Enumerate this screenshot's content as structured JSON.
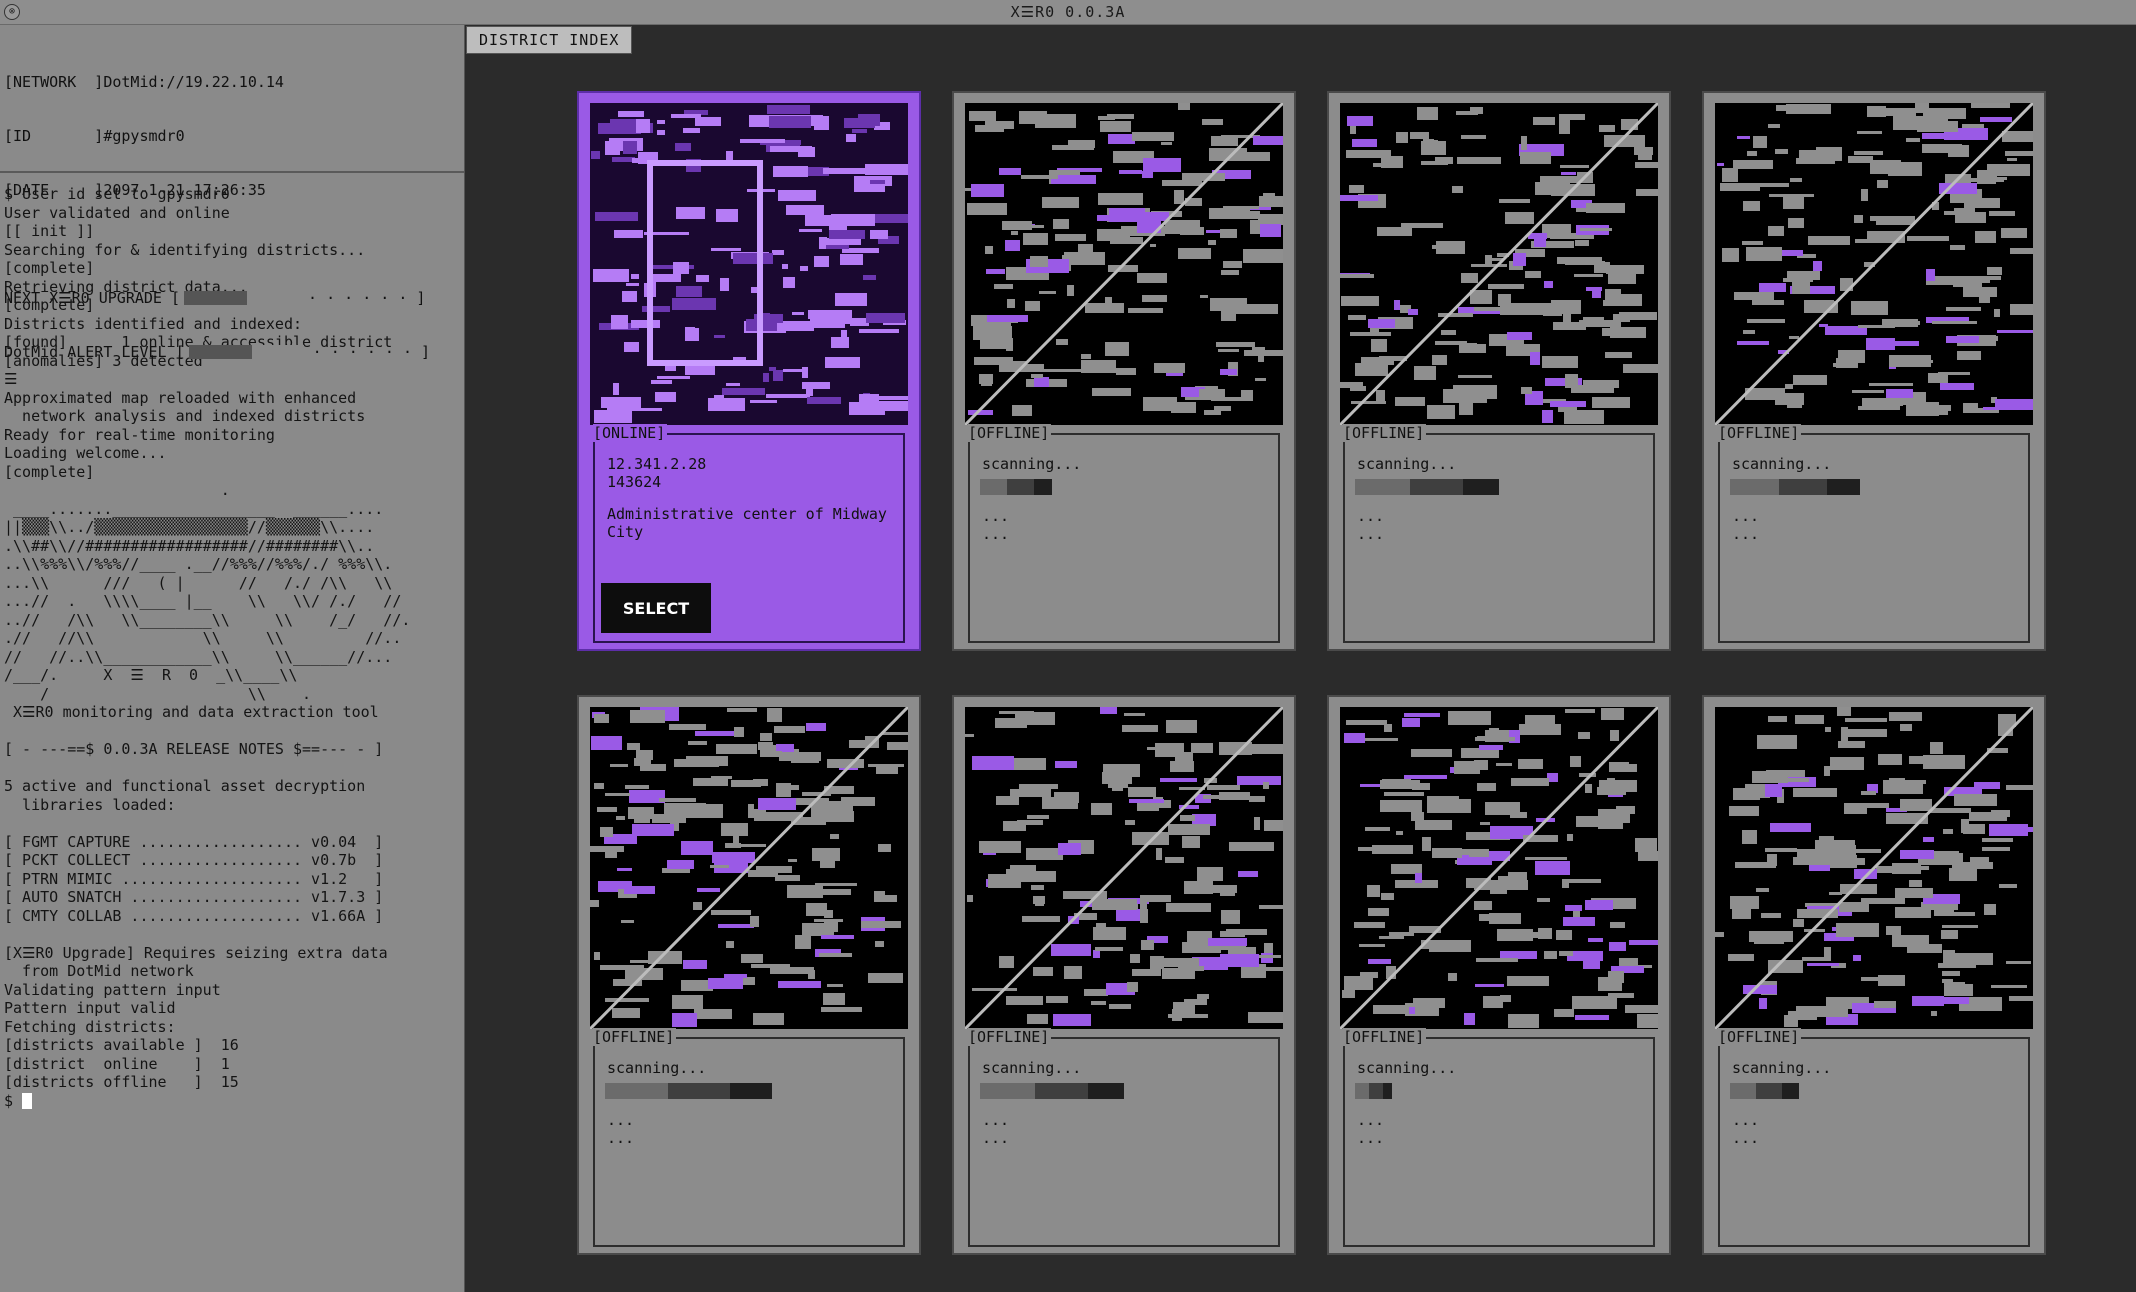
{
  "window": {
    "title": "X☰R0 0.0.3A"
  },
  "status": {
    "network_label": "[NETWORK  ]",
    "network_value": "DotMid://19.22.10.14",
    "id_label": "[ID       ]",
    "id_value": "#gpysmdr0",
    "date_label": "[DATE     ]",
    "date_value": "2097-1-21 17:26:35",
    "upgrade_label": "NEXT X☰R0 UPGRADE [",
    "upgrade_level": 0.55,
    "alert_label": "DotMid ALERT LEVEL [",
    "alert_level": 0.55,
    "meter_tail": " · · · · · · ]"
  },
  "log": [
    "$ User id set to gpysmdr0",
    "User validated and online",
    "[[ init ]]",
    "Searching for & identifying districts...",
    "[complete]",
    "Retrieving district data...",
    "[complete]",
    "Districts identified and indexed:",
    "[found]      1 online & accessible district",
    "[anomalies] 3 detected",
    "☰",
    "Approximated map reloaded with enhanced",
    "  network analysis and indexed districts",
    "Ready for real-time monitoring",
    "Loading welcome...",
    "[complete]",
    "                        .",
    " ____.......__________________  ______....",
    "||▒▒▒\\\\../▒▒▒▒▒▒▒▒▒▒▒▒▒▒▒▒▒//▒▒▒▒▒▒\\\\....",
    ".\\\\##\\\\//##################//########\\\\..",
    "..\\\\%%%\\\\/%%%//____ .__//%%%//%%%/./ %%%\\\\.",
    "...\\\\      ///   ( |      //   /./ /\\\\   \\\\",
    "...//  .   \\\\\\\\____ |__    \\\\   \\\\/ /./   //",
    "..//   /\\\\   \\\\________\\\\     \\\\    /_/   //.",
    ".//   //\\\\            \\\\     \\\\         //..",
    "//   //..\\\\____________\\\\     \\\\______//...",
    "/___/.     X  ☰  R  0  _\\\\____\\\\",
    "    /                      \\\\    .",
    " X☰R0 monitoring and data extraction tool",
    "",
    "[ - ---==$ 0.0.3A RELEASE NOTES $==--- - ]",
    "",
    "5 active and functional asset decryption",
    "  libraries loaded:",
    "",
    "[ FGMT CAPTURE .................. v0.04  ]",
    "[ PCKT COLLECT .................. v0.7b  ]",
    "[ PTRN MIMIC .................... v1.2   ]",
    "[ AUTO SNATCH ................... v1.7.3 ]",
    "[ CMTY COLLAB ................... v1.66A ]",
    "",
    "[X☰R0 Upgrade] Requires seizing extra data",
    "  from DotMid network",
    "Validating pattern input",
    "Pattern input valid",
    "Fetching districts:",
    "[districts available ]  16",
    "[district  online    ]  1",
    "[districts offline   ]  15",
    "$ "
  ],
  "tab": {
    "label": "DISTRICT INDEX"
  },
  "colors": {
    "accent": "#9a5ae6",
    "card": "#8c8c8c",
    "background": "#2b2b2b"
  },
  "cards": [
    {
      "state": "[ONLINE]",
      "ip": "12.341.2.28",
      "code": "143624",
      "description": "Administrative center of Midway City",
      "button": "SELECT"
    },
    {
      "state": "[OFFLINE]",
      "status": "scanning...",
      "progress": 0.25,
      "more": "...\n..."
    },
    {
      "state": "[OFFLINE]",
      "status": "scanning...",
      "progress": 0.5,
      "more": "...\n..."
    },
    {
      "state": "[OFFLINE]",
      "status": "scanning...",
      "progress": 0.45,
      "more": "...\n..."
    },
    {
      "state": "[OFFLINE]",
      "status": "scanning...",
      "progress": 0.58,
      "more": "...\n..."
    },
    {
      "state": "[OFFLINE]",
      "status": "scanning...",
      "progress": 0.5,
      "more": "...\n..."
    },
    {
      "state": "[OFFLINE]",
      "status": "scanning...",
      "progress": 0.13,
      "more": "...\n..."
    },
    {
      "state": "[OFFLINE]",
      "status": "scanning...",
      "progress": 0.24,
      "more": "...\n..."
    }
  ]
}
